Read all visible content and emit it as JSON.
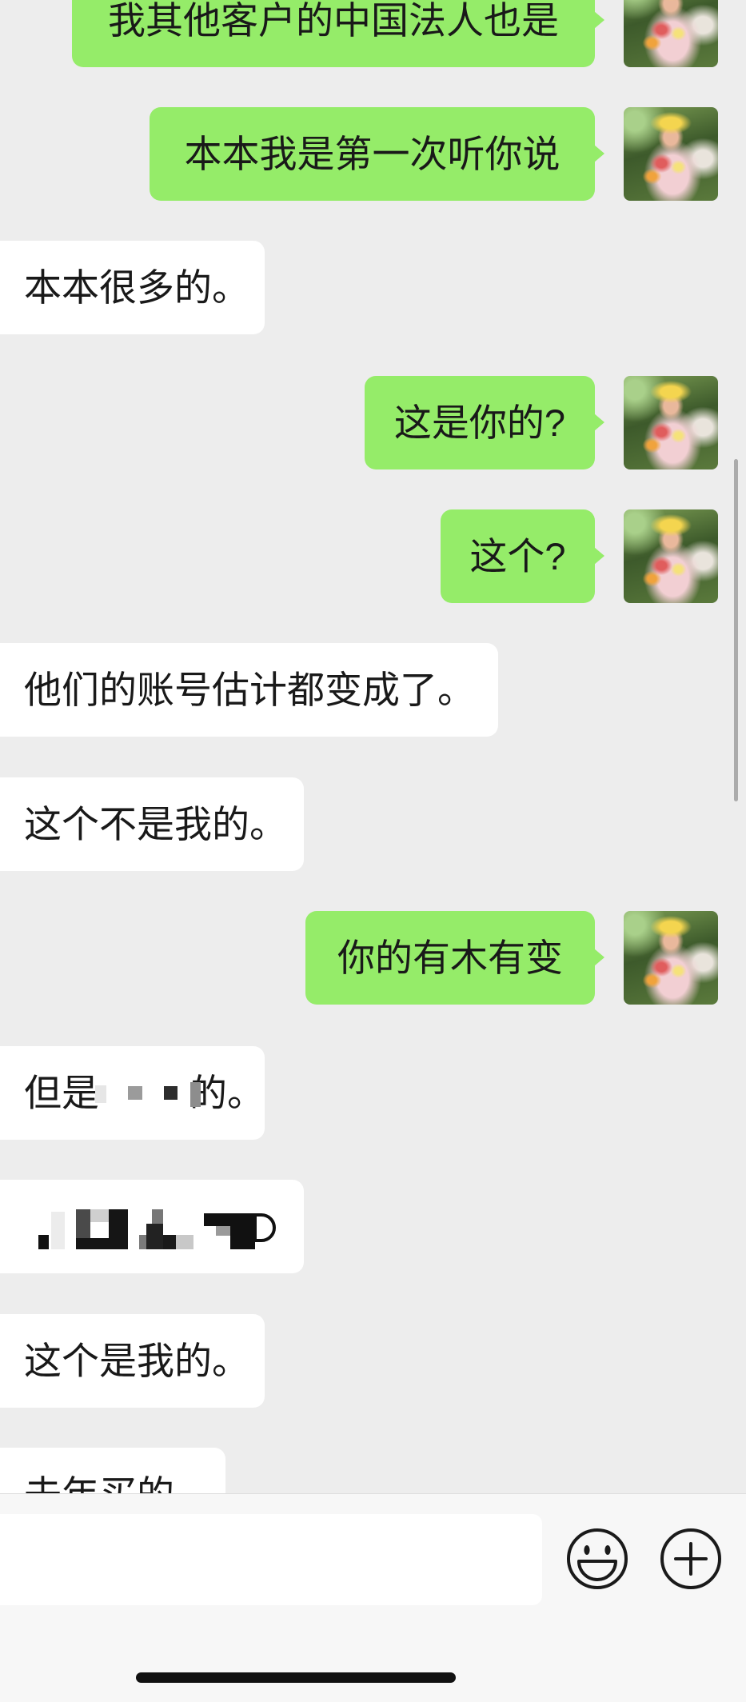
{
  "messages": [
    {
      "outgoing": true,
      "text": "我其他客户的中国法人也是"
    },
    {
      "outgoing": true,
      "text": "本本我是第一次听你说"
    },
    {
      "outgoing": false,
      "text": "本本很多的。"
    },
    {
      "outgoing": true,
      "text": "这是你的?"
    },
    {
      "outgoing": true,
      "text": "这个?"
    },
    {
      "outgoing": false,
      "text": "他们的账号估计都变成了。"
    },
    {
      "outgoing": false,
      "text": "这个不是我的。"
    },
    {
      "outgoing": true,
      "text": "你的有木有变"
    },
    {
      "outgoing": false,
      "text_before": "但是",
      "text_after": "的。",
      "redacted": true
    },
    {
      "outgoing": false,
      "redacted": true
    },
    {
      "outgoing": false,
      "text": "这个是我的。"
    },
    {
      "outgoing": false,
      "text": "去年买的"
    }
  ],
  "input": {
    "value": "",
    "placeholder": ""
  },
  "icons": {
    "avatar": "avatar-photo",
    "emoji_button": "emoji-icon",
    "more_button": "plus-icon"
  },
  "colors": {
    "chat_background": "#ededed",
    "sent_bubble": "#95ec69",
    "received_bubble": "#ffffff",
    "input_bar_background": "#f7f7f7"
  }
}
